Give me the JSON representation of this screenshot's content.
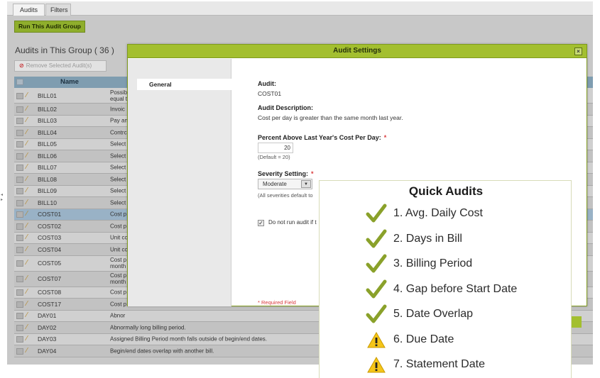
{
  "tabs": [
    "Audits",
    "Filters"
  ],
  "run_button": "Run This Audit Group",
  "group_title": "Audits in This Group ( 36 )",
  "remove_button": "Remove Selected Audit(s)",
  "grid_header_name": "Name",
  "rows": [
    {
      "code": "BILL01",
      "desc": "Possib\nequal t",
      "tall": true
    },
    {
      "code": "BILL02",
      "desc": "Invoic"
    },
    {
      "code": "BILL03",
      "desc": "Pay an"
    },
    {
      "code": "BILL04",
      "desc": "Contrc"
    },
    {
      "code": "BILL05",
      "desc": "Select"
    },
    {
      "code": "BILL06",
      "desc": "Select"
    },
    {
      "code": "BILL07",
      "desc": "Select"
    },
    {
      "code": "BILL08",
      "desc": "Select"
    },
    {
      "code": "BILL09",
      "desc": "Select"
    },
    {
      "code": "BILL10",
      "desc": "Select"
    },
    {
      "code": "COST01",
      "desc": "Cost p",
      "selected": true
    },
    {
      "code": "COST02",
      "desc": "Cost p"
    },
    {
      "code": "COST03",
      "desc": "Unit cc"
    },
    {
      "code": "COST04",
      "desc": "Unit cc"
    },
    {
      "code": "COST05",
      "desc": "Cost p\nmonth",
      "tall": true
    },
    {
      "code": "COST07",
      "desc": "Cost p\nmonth",
      "tall": true
    },
    {
      "code": "COST08",
      "desc": "Cost p"
    },
    {
      "code": "COST17",
      "desc": "Cost p"
    },
    {
      "code": "DAY01",
      "desc": "Abnor"
    },
    {
      "code": "DAY02",
      "desc": "Abnormally long billing period."
    },
    {
      "code": "DAY03",
      "desc": "Assigned Billing Period month falls outside of begin/end dates."
    },
    {
      "code": "DAY04",
      "desc": "Begin/end dates overlap with another bill."
    }
  ],
  "dialog": {
    "title": "Audit Settings",
    "nav_item": "General",
    "audit_label": "Audit:",
    "audit_value": "COST01",
    "desc_label": "Audit Description:",
    "desc_value": "Cost per day is greater than the same month last year.",
    "percent_label": "Percent Above Last Year's Cost Per Day:",
    "percent_value": "20",
    "percent_default": "(Default = 20)",
    "severity_label": "Severity Setting:",
    "severity_value": "Moderate",
    "severity_note": "(All severities default to",
    "checkbox_label": "Do not run audit if t",
    "checkbox_checked": true,
    "required_marker": "*",
    "required_note": "* Required Field"
  },
  "quick_audits": {
    "title": "Quick Audits",
    "items": [
      {
        "label": "1. Avg. Daily Cost",
        "status": "check-icon"
      },
      {
        "label": "2. Days in Bill",
        "status": "check-icon"
      },
      {
        "label": "3. Billing Period",
        "status": "check-icon"
      },
      {
        "label": "4. Gap before Start Date",
        "status": "check-icon"
      },
      {
        "label": "5. Date Overlap",
        "status": "check-icon"
      },
      {
        "label": "6. Due Date",
        "status": "warning-icon"
      },
      {
        "label": "7. Statement Date",
        "status": "warning-icon"
      }
    ]
  },
  "colors": {
    "accent_green": "#a3bf2f",
    "check_green": "#8aa12a",
    "warning_yellow": "#f5c518"
  }
}
